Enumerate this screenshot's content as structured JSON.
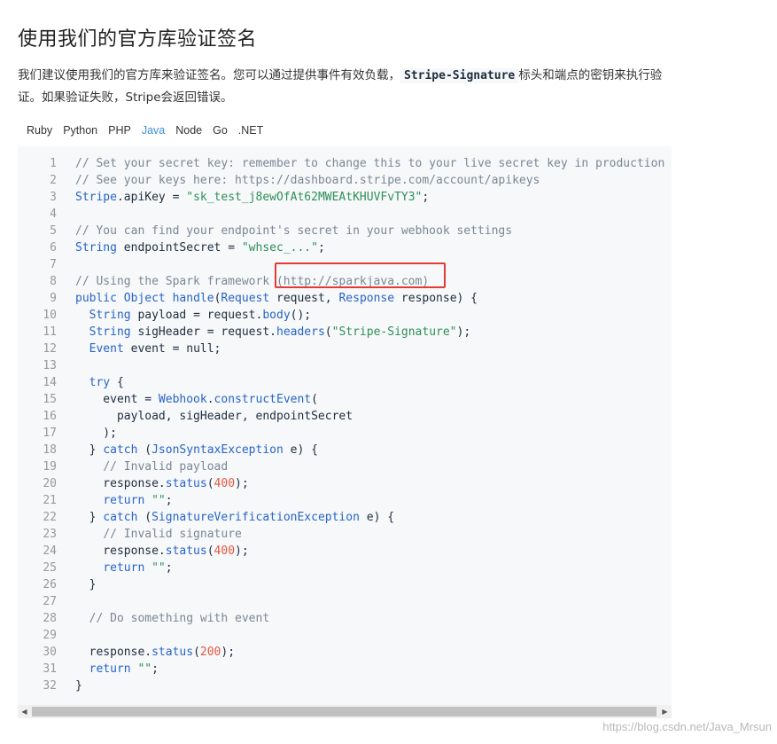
{
  "page": {
    "title": "使用我们的官方库验证签名",
    "intro_part1": "我们建议使用我们的官方库来验证签名。您可以通过提供事件有效负载，",
    "intro_code": "Stripe-Signature",
    "intro_part2": "标头和端点的密钥来执行验证。如果验证失败，Stripe会返回错误。",
    "watermark": "https://blog.csdn.net/Java_Mrsun"
  },
  "tabs": [
    {
      "label": "Ruby",
      "active": false
    },
    {
      "label": "Python",
      "active": false
    },
    {
      "label": "PHP",
      "active": false
    },
    {
      "label": "Java",
      "active": true
    },
    {
      "label": "Node",
      "active": false
    },
    {
      "label": "Go",
      "active": false
    },
    {
      "label": ".NET",
      "active": false
    }
  ],
  "code_lines": [
    [
      [
        "comment",
        "// Set your secret key: remember to change this to your live secret key in production"
      ]
    ],
    [
      [
        "comment",
        "// See your keys here: https://dashboard.stripe.com/account/apikeys"
      ]
    ],
    [
      [
        "type",
        "Stripe"
      ],
      [
        "plain",
        ".apiKey = "
      ],
      [
        "str",
        "\"sk_test_j8ewOfAt62MWEAtKHUVFvTY3\""
      ],
      [
        "plain",
        ";"
      ]
    ],
    [],
    [
      [
        "comment",
        "// You can find your endpoint's secret in your webhook settings"
      ]
    ],
    [
      [
        "type",
        "String"
      ],
      [
        "plain",
        " endpointSecret = "
      ],
      [
        "str",
        "\"whsec_...\""
      ],
      [
        "plain",
        ";"
      ]
    ],
    [],
    [
      [
        "comment",
        "// Using the Spark framework (http://sparkjava.com)"
      ]
    ],
    [
      [
        "kw",
        "public"
      ],
      [
        "plain",
        " "
      ],
      [
        "type",
        "Object"
      ],
      [
        "plain",
        " "
      ],
      [
        "kw",
        "handle"
      ],
      [
        "plain",
        "("
      ],
      [
        "type",
        "Request"
      ],
      [
        "plain",
        " request, "
      ],
      [
        "type",
        "Response"
      ],
      [
        "plain",
        " response) {"
      ]
    ],
    [
      [
        "plain",
        "  "
      ],
      [
        "type",
        "String"
      ],
      [
        "plain",
        " payload = request."
      ],
      [
        "kw",
        "body"
      ],
      [
        "plain",
        "();"
      ]
    ],
    [
      [
        "plain",
        "  "
      ],
      [
        "type",
        "String"
      ],
      [
        "plain",
        " sigHeader = request."
      ],
      [
        "kw",
        "headers"
      ],
      [
        "plain",
        "("
      ],
      [
        "str",
        "\"Stripe-Signature\""
      ],
      [
        "plain",
        ");"
      ]
    ],
    [
      [
        "plain",
        "  "
      ],
      [
        "type",
        "Event"
      ],
      [
        "plain",
        " event = null;"
      ]
    ],
    [],
    [
      [
        "plain",
        "  "
      ],
      [
        "kw",
        "try"
      ],
      [
        "plain",
        " {"
      ]
    ],
    [
      [
        "plain",
        "    event = "
      ],
      [
        "type",
        "Webhook"
      ],
      [
        "plain",
        "."
      ],
      [
        "kw",
        "constructEvent"
      ],
      [
        "plain",
        "("
      ]
    ],
    [
      [
        "plain",
        "      payload, sigHeader, endpointSecret"
      ]
    ],
    [
      [
        "plain",
        "    );"
      ]
    ],
    [
      [
        "plain",
        "  } "
      ],
      [
        "kw",
        "catch"
      ],
      [
        "plain",
        " ("
      ],
      [
        "type",
        "JsonSyntaxException"
      ],
      [
        "plain",
        " e) {"
      ]
    ],
    [
      [
        "plain",
        "    "
      ],
      [
        "comment",
        "// Invalid payload"
      ]
    ],
    [
      [
        "plain",
        "    response."
      ],
      [
        "kw",
        "status"
      ],
      [
        "plain",
        "("
      ],
      [
        "num",
        "400"
      ],
      [
        "plain",
        ");"
      ]
    ],
    [
      [
        "plain",
        "    "
      ],
      [
        "kw",
        "return"
      ],
      [
        "plain",
        " "
      ],
      [
        "str",
        "\"\""
      ],
      [
        "plain",
        ";"
      ]
    ],
    [
      [
        "plain",
        "  } "
      ],
      [
        "kw",
        "catch"
      ],
      [
        "plain",
        " ("
      ],
      [
        "type",
        "SignatureVerificationException"
      ],
      [
        "plain",
        " e) {"
      ]
    ],
    [
      [
        "plain",
        "    "
      ],
      [
        "comment",
        "// Invalid signature"
      ]
    ],
    [
      [
        "plain",
        "    response."
      ],
      [
        "kw",
        "status"
      ],
      [
        "plain",
        "("
      ],
      [
        "num",
        "400"
      ],
      [
        "plain",
        ");"
      ]
    ],
    [
      [
        "plain",
        "    "
      ],
      [
        "kw",
        "return"
      ],
      [
        "plain",
        " "
      ],
      [
        "str",
        "\"\""
      ],
      [
        "plain",
        ";"
      ]
    ],
    [
      [
        "plain",
        "  }"
      ]
    ],
    [],
    [
      [
        "plain",
        "  "
      ],
      [
        "comment",
        "// Do something with event"
      ]
    ],
    [],
    [
      [
        "plain",
        "  response."
      ],
      [
        "kw",
        "status"
      ],
      [
        "plain",
        "("
      ],
      [
        "num",
        "200"
      ],
      [
        "plain",
        ");"
      ]
    ],
    [
      [
        "plain",
        "  "
      ],
      [
        "kw",
        "return"
      ],
      [
        "plain",
        " "
      ],
      [
        "str",
        "\"\""
      ],
      [
        "plain",
        ";"
      ]
    ],
    [
      [
        "plain",
        "}"
      ]
    ]
  ],
  "scrollbar": {
    "left_arrow_icon": "◀",
    "right_arrow_icon": "▶"
  }
}
